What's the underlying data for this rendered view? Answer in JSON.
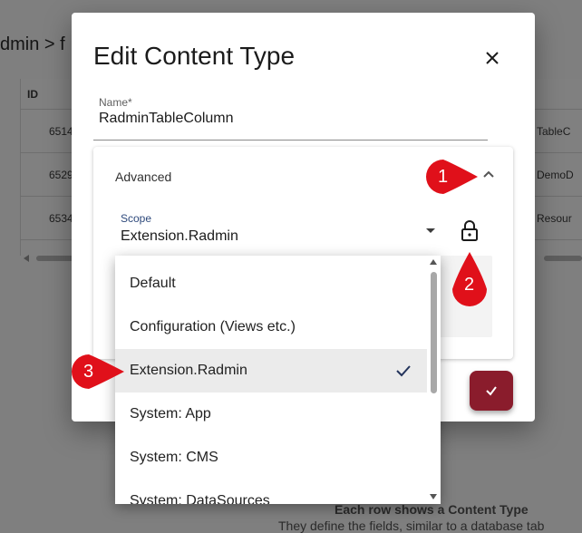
{
  "background": {
    "breadcrumb": "dmin > f",
    "table": {
      "header_id": "ID",
      "rows": [
        {
          "id": "6514",
          "name": "TableC"
        },
        {
          "id": "6529",
          "name": "DemoD"
        },
        {
          "id": "6534",
          "name": "Resour"
        }
      ]
    },
    "footer_title": "Each row shows a Content Type",
    "footer_subtitle": "They define the fields, similar to a database tab"
  },
  "dialog": {
    "title": "Edit Content Type",
    "name_label": "Name*",
    "name_value": "RadminTableColumn",
    "advanced_label": "Advanced",
    "scope_label": "Scope",
    "scope_value": "Extension.Radmin"
  },
  "dropdown": {
    "options": [
      {
        "label": "Default",
        "selected": false
      },
      {
        "label": "Configuration (Views etc.)",
        "selected": false
      },
      {
        "label": "Extension.Radmin",
        "selected": true
      },
      {
        "label": "System: App",
        "selected": false
      },
      {
        "label": "System: CMS",
        "selected": false
      },
      {
        "label": "System: DataSources",
        "selected": false
      }
    ]
  },
  "markers": [
    "1",
    "2",
    "3"
  ],
  "icons": {
    "close": "close-icon",
    "chevron": "chevron-up-icon",
    "lock": "lock-open-icon",
    "check": "check-icon",
    "save": "check-icon"
  },
  "colors": {
    "accent": "#24345c",
    "marker": "#e0101a",
    "save_fab": "#8a1c2c"
  }
}
